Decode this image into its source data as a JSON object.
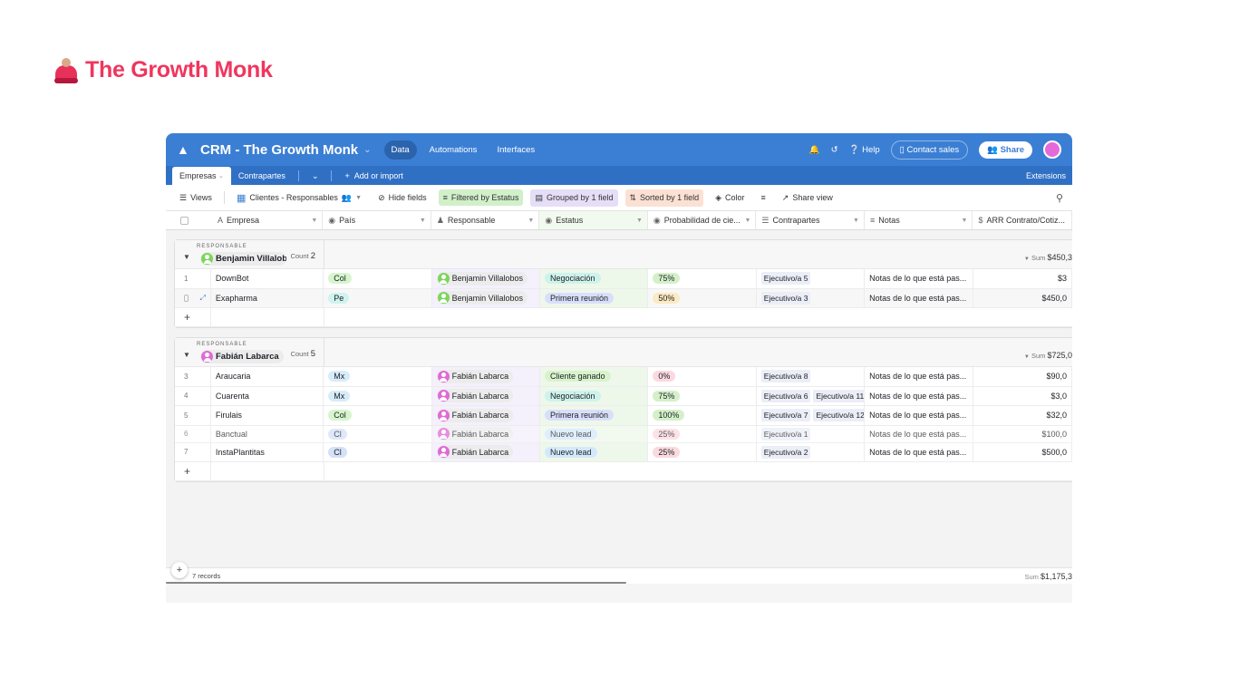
{
  "brand": {
    "title": "The Growth Monk",
    "icon": "monk-icon",
    "color": "#f0365e"
  },
  "topbar": {
    "base_name": "CRM - The Growth Monk",
    "tabs": [
      {
        "label": "Data",
        "active": true
      },
      {
        "label": "Automations"
      },
      {
        "label": "Interfaces"
      }
    ],
    "help_label": "Help",
    "contact_label": "Contact sales",
    "share_label": "Share",
    "accent": "#3b7fd4"
  },
  "tables": {
    "tabs": [
      "Empresas",
      "Contrapartes"
    ],
    "add_label": "Add or import",
    "extensions_label": "Extensions"
  },
  "toolbar": {
    "views_label": "Views",
    "view_name": "Clientes - Responsables",
    "hide_fields": "Hide fields",
    "filter": "Filtered by Estatus",
    "group": "Grouped by 1 field",
    "sort": "Sorted by 1 field",
    "color": "Color",
    "share_view": "Share view"
  },
  "columns": [
    "Empresa",
    "País",
    "Responsable",
    "Estatus",
    "Probabilidad de cie...",
    "Contrapartes",
    "Notas",
    "ARR Contrato/Cotiz..."
  ],
  "groups": [
    {
      "label": "RESPONSABLE",
      "name": "Benjamin Villalobos",
      "name_visible": "Benjamin Villalob",
      "count_label": "Count",
      "count": "2",
      "sum_label": "Sum",
      "sum": "$450,3",
      "rows": [
        {
          "num": "1",
          "empresa": "DownBot",
          "pais": "Col",
          "responsable": "Benjamin Villalobos",
          "estatus": "Negociación",
          "prob": "75%",
          "contrapartes": [
            "Ejecutivo/a 5"
          ],
          "notas": "Notas de lo que está pas...",
          "arr": "$3"
        },
        {
          "num": "",
          "empresa": "Exapharma",
          "pais": "Pe",
          "responsable": "Benjamin Villalobos",
          "estatus": "Primera reunión",
          "prob": "50%",
          "contrapartes": [
            "Ejecutivo/a 3"
          ],
          "notas": "Notas de lo que está pas...",
          "arr": "$450,0"
        }
      ]
    },
    {
      "label": "RESPONSABLE",
      "name": "Fabián Labarca",
      "name_visible": "Fabián Labarca",
      "count_label": "Count",
      "count": "5",
      "sum_label": "Sum",
      "sum": "$725,0",
      "rows": [
        {
          "num": "3",
          "empresa": "Araucaria",
          "pais": "Mx",
          "responsable": "Fabián Labarca",
          "estatus": "Cliente ganado",
          "prob": "0%",
          "contrapartes": [
            "Ejecutivo/a 8"
          ],
          "notas": "Notas de lo que está pas...",
          "arr": "$90,0"
        },
        {
          "num": "4",
          "empresa": "Cuarenta",
          "pais": "Mx",
          "responsable": "Fabián Labarca",
          "estatus": "Negociación",
          "prob": "75%",
          "contrapartes": [
            "Ejecutivo/a 6",
            "Ejecutivo/a 11"
          ],
          "notas": "Notas de lo que está pas...",
          "arr": "$3,0"
        },
        {
          "num": "5",
          "empresa": "Firulais",
          "pais": "Col",
          "responsable": "Fabián Labarca",
          "estatus": "Primera reunión",
          "prob": "100%",
          "contrapartes": [
            "Ejecutivo/a 7",
            "Ejecutivo/a 12"
          ],
          "notas": "Notas de lo que está pas...",
          "arr": "$32,0"
        },
        {
          "num": "6",
          "empresa": "Banctual",
          "pais": "Cl",
          "responsable": "Fabián Labarca",
          "estatus": "Nuevo lead",
          "prob": "25%",
          "contrapartes": [
            "Ejecutivo/a 1"
          ],
          "notas": "Notas de lo que está pas...",
          "arr": "$100,0"
        },
        {
          "num": "7",
          "empresa": "InstaPlantitas",
          "pais": "Cl",
          "responsable": "Fabián Labarca",
          "estatus": "Nuevo lead",
          "prob": "25%",
          "contrapartes": [
            "Ejecutivo/a 2"
          ],
          "notas": "Notas de lo que está pas...",
          "arr": "$500,0"
        }
      ]
    }
  ],
  "footer": {
    "records": "7 records",
    "sum_label": "Sum",
    "sum": "$1,175,3"
  }
}
